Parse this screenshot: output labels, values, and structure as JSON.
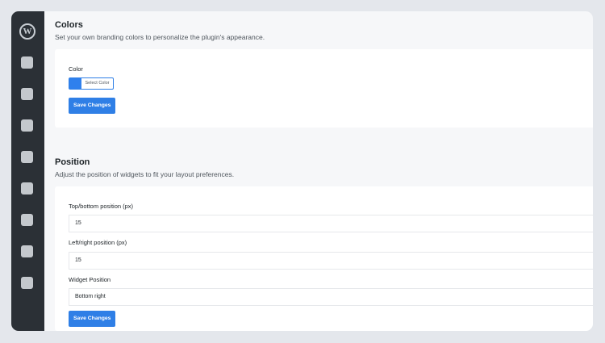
{
  "sidebar": {
    "logo_glyph": "W",
    "items": [
      "nav-item-1",
      "nav-item-2",
      "nav-item-3",
      "nav-item-4",
      "nav-item-5",
      "nav-item-6",
      "nav-item-7",
      "nav-item-8"
    ]
  },
  "colors_section": {
    "title": "Colors",
    "description": "Set your own branding colors to personalize the plugin's appearance.",
    "color_label": "Color",
    "color_value": "#2f80ed",
    "select_color_label": "Select Color",
    "save_label": "Save Changes"
  },
  "position_section": {
    "title": "Position",
    "description": "Adjust the position of widgets to fit your layout preferences.",
    "top_bottom_label": "Top/bottom position (px)",
    "top_bottom_value": "15",
    "left_right_label": "Left/right position (px)",
    "left_right_value": "15",
    "widget_position_label": "Widget Position",
    "widget_position_value": "Bottom right",
    "save_label": "Save Changes"
  }
}
